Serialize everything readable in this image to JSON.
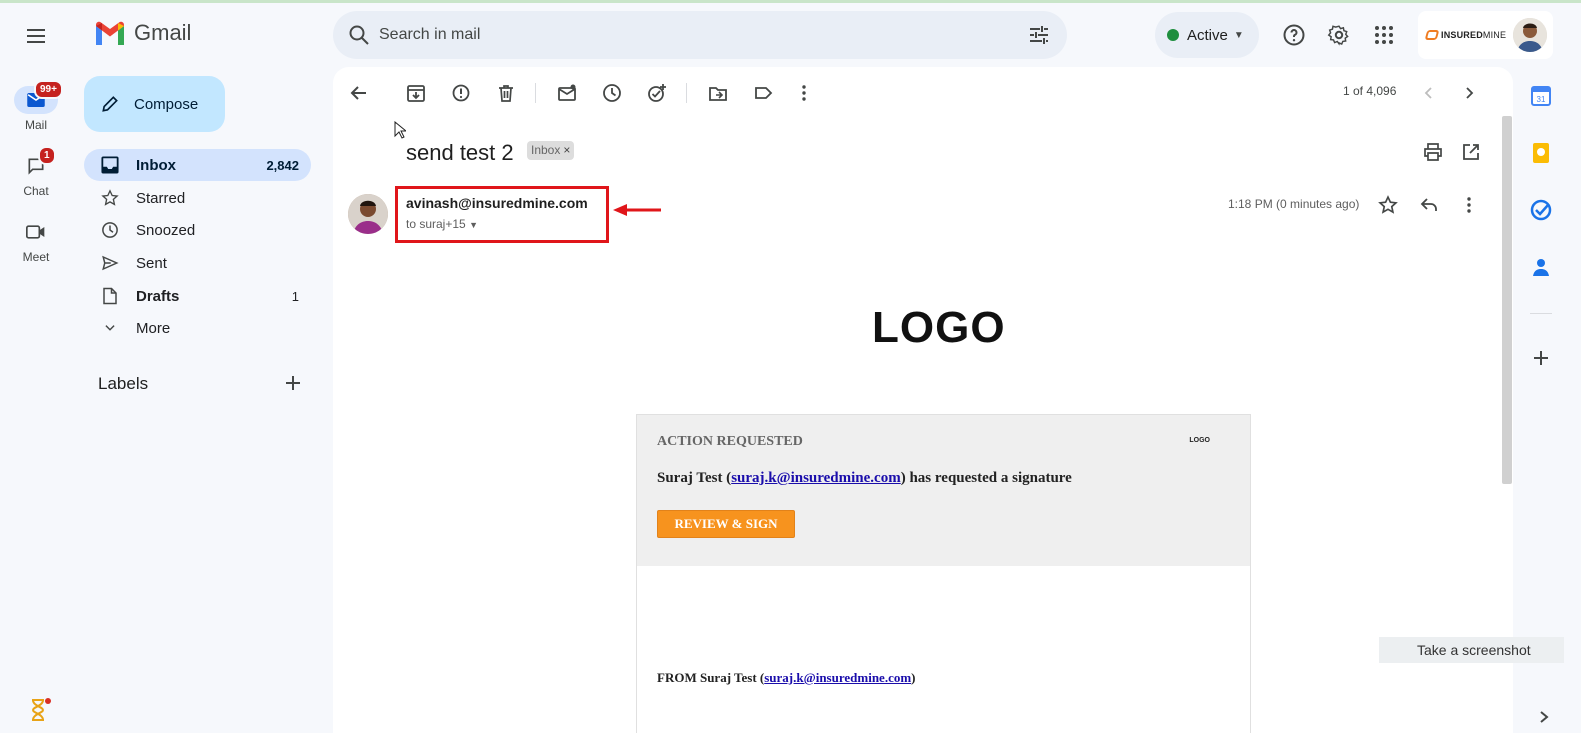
{
  "app": {
    "name": "Gmail"
  },
  "rail": {
    "items": [
      {
        "label": "Mail",
        "badge": "99+"
      },
      {
        "label": "Chat",
        "badge": "1"
      },
      {
        "label": "Meet",
        "badge": ""
      }
    ]
  },
  "search": {
    "placeholder": "Search in mail"
  },
  "status": {
    "label": "Active"
  },
  "account": {
    "brand_bold": "INSURED",
    "brand_rest": "MINE"
  },
  "nav": {
    "compose": "Compose",
    "items": [
      {
        "label": "Inbox",
        "count": "2,842"
      },
      {
        "label": "Starred",
        "count": ""
      },
      {
        "label": "Snoozed",
        "count": ""
      },
      {
        "label": "Sent",
        "count": ""
      },
      {
        "label": "Drafts",
        "count": "1"
      },
      {
        "label": "More",
        "count": ""
      }
    ],
    "labels_heading": "Labels"
  },
  "toolbar": {
    "pager": "1 of 4,096"
  },
  "email": {
    "subject": "send test 2",
    "tag": "Inbox",
    "tag_close": "×",
    "sender": "avinash@insuredmine.com",
    "to": "to suraj+15",
    "time": "1:18 PM (0 minutes ago)",
    "logo_text": "LOGO",
    "card": {
      "heading": "ACTION REQUESTED",
      "small_logo": "LOGO",
      "requester": "Suraj Test (",
      "requester_email": "suraj.k@insuredmine.com",
      "request_text": ") has requested a signature",
      "button": "REVIEW & SIGN",
      "from_prefix": "FROM Suraj Test (",
      "from_email": "suraj.k@insuredmine.com",
      "from_suffix": ")"
    }
  },
  "overlay": {
    "toast": "Take a screenshot"
  },
  "colors": {
    "accent": "#c2e7ff",
    "active_nav": "#d3e3fd",
    "highlight_box": "#e0161a",
    "review_button": "#f7931e",
    "status_dot": "#1e8e3e"
  }
}
